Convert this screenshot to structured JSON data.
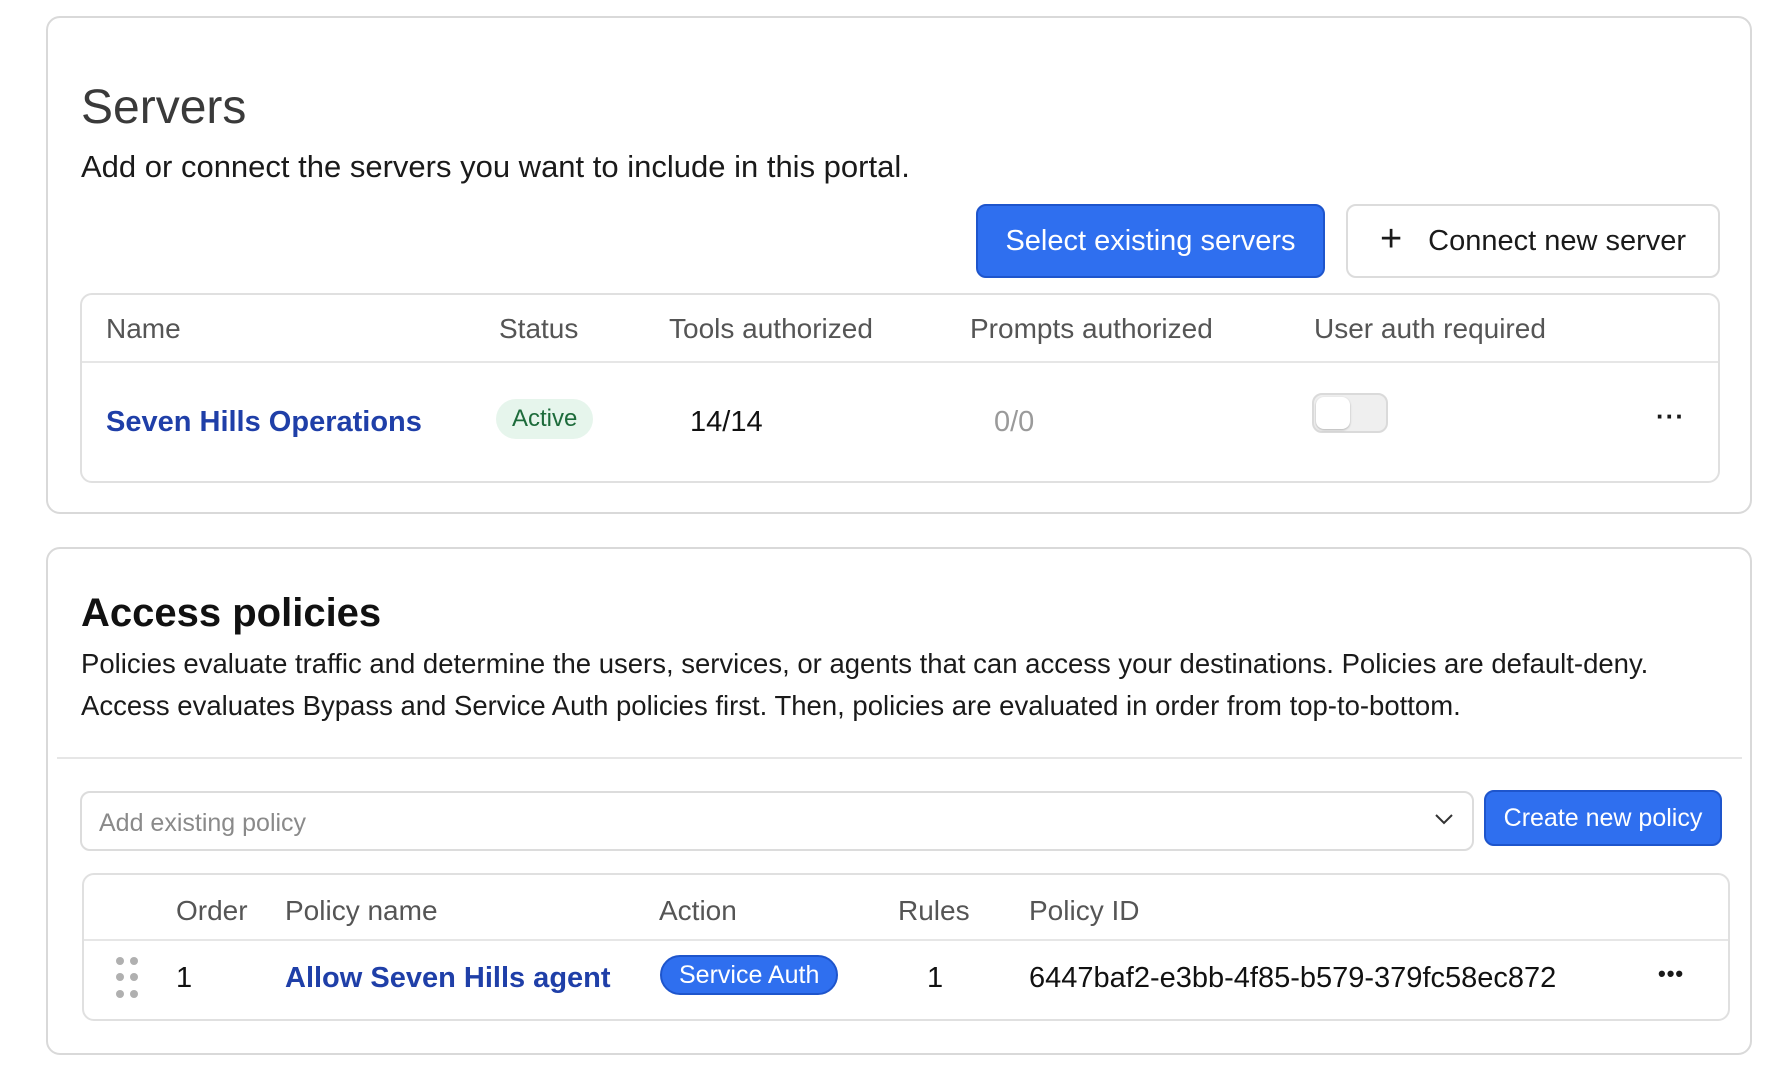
{
  "servers": {
    "title": "Servers",
    "subtitle": "Add or connect the servers you want to include in this portal.",
    "select_existing_label": "Select existing servers",
    "connect_new_label": "Connect new server",
    "connect_new_icon": "plus-icon",
    "table": {
      "columns": [
        "Name",
        "Status",
        "Tools authorized",
        "Prompts authorized",
        "User auth required"
      ],
      "rows": [
        {
          "name": "Seven Hills Operations",
          "status": "Active",
          "tools_authorized": "14/14",
          "prompts_authorized": "0/0",
          "user_auth_required": false,
          "menu": "···"
        }
      ]
    }
  },
  "policies": {
    "title": "Access policies",
    "description": "Policies evaluate traffic and determine the users, services, or agents that can access your destinations. Policies are default-deny. Access evaluates Bypass and Service Auth policies first. Then, policies are evaluated in order from top-to-bottom.",
    "add_placeholder": "Add existing policy",
    "create_label": "Create new policy",
    "table": {
      "columns": [
        "Order",
        "Policy name",
        "Action",
        "Rules",
        "Policy ID"
      ],
      "rows": [
        {
          "order": "1",
          "name": "Allow Seven Hills agent",
          "action": "Service Auth",
          "rules": "1",
          "policy_id": "6447baf2-e3bb-4f85-b579-379fc58ec872",
          "menu": "•••"
        }
      ]
    }
  },
  "colors": {
    "primary": "#2f6fef",
    "link": "#1f3fa8",
    "active_badge_bg": "#e6f5ec",
    "active_badge_text": "#1d6b3b"
  }
}
